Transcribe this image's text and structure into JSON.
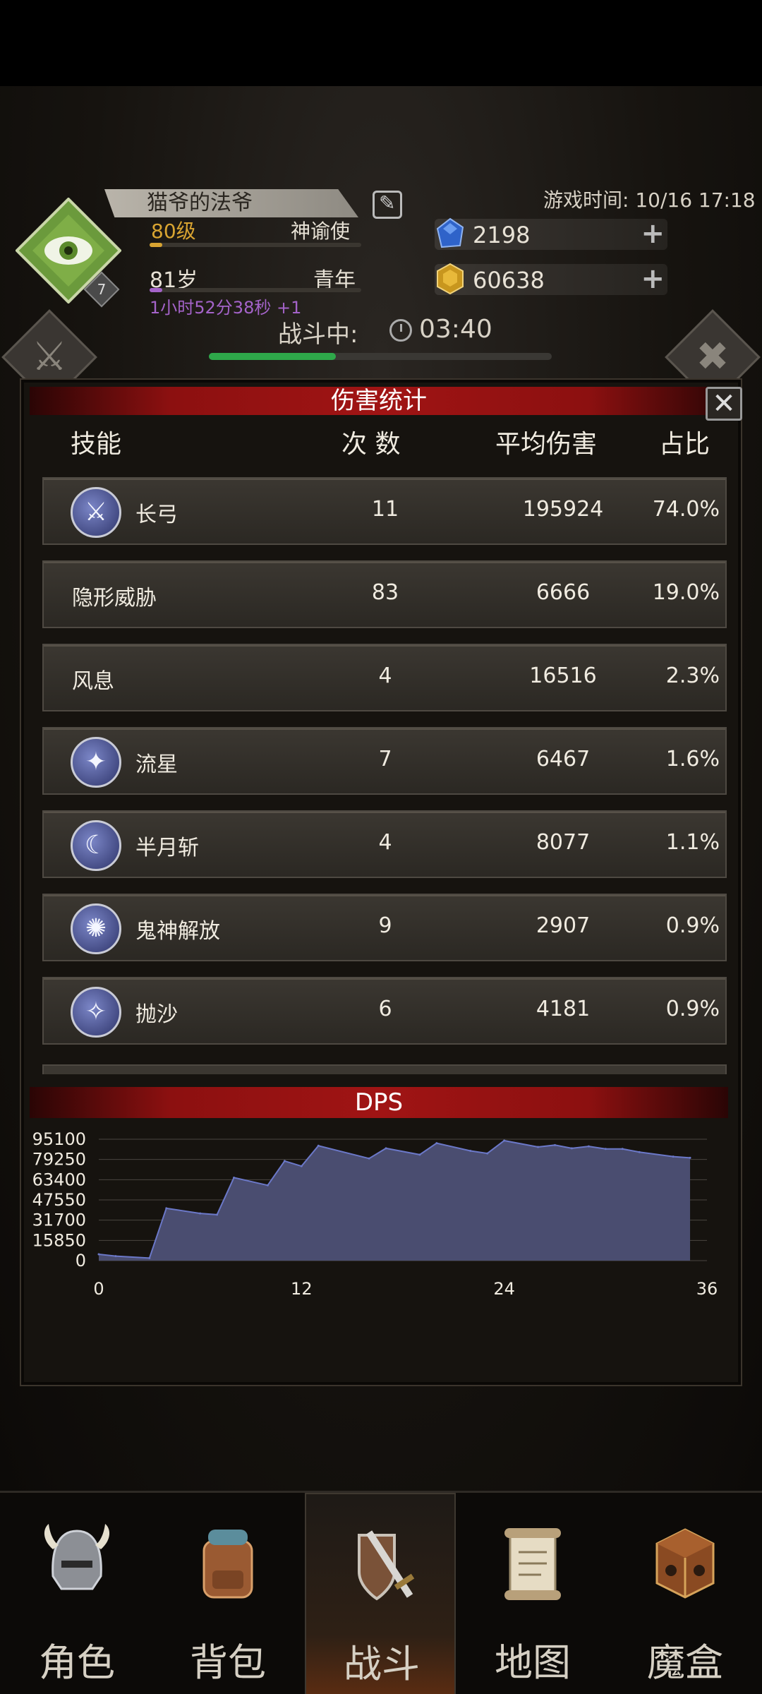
{
  "header": {
    "player_name": "猫爷的法爷",
    "level": "80级",
    "class_name": "神谕使",
    "badge_number": "7",
    "age": "81岁",
    "life_stage": "青年",
    "online_timer": "1小时52分38秒 +1",
    "game_time": "游戏时间: 10/16 17:18",
    "currencies": [
      {
        "icon": "blue-gem-icon",
        "value": "2198"
      },
      {
        "icon": "gold-gem-icon",
        "value": "60638"
      }
    ],
    "battle_label": "战斗中:",
    "battle_timer": "03:40",
    "battle_progress_percent": 37
  },
  "damage_dialog": {
    "title": "伤害统计",
    "close_label": "✕",
    "columns": {
      "skill": "技能",
      "count": "次 数",
      "avg": "平均伤害",
      "ratio": "占比"
    },
    "rows": [
      {
        "name": "长弓",
        "icon": "sword-skill-icon",
        "glyph": "⚔",
        "count": "11",
        "avg": "195924",
        "ratio": "74.0%"
      },
      {
        "name": "隐形威胁",
        "icon": "",
        "glyph": "",
        "count": "83",
        "avg": "6666",
        "ratio": "19.0%"
      },
      {
        "name": "风息",
        "icon": "",
        "glyph": "",
        "count": "4",
        "avg": "16516",
        "ratio": "2.3%"
      },
      {
        "name": "流星",
        "icon": "meteor-skill-icon",
        "glyph": "✦",
        "count": "7",
        "avg": "6467",
        "ratio": "1.6%"
      },
      {
        "name": "半月斩",
        "icon": "crescent-skill-icon",
        "glyph": "☾",
        "count": "4",
        "avg": "8077",
        "ratio": "1.1%"
      },
      {
        "name": "鬼神解放",
        "icon": "spirit-skill-icon",
        "glyph": "✺",
        "count": "9",
        "avg": "2907",
        "ratio": "0.9%"
      },
      {
        "name": "抛沙",
        "icon": "sand-skill-icon",
        "glyph": "✧",
        "count": "6",
        "avg": "4181",
        "ratio": "0.9%"
      }
    ],
    "dps_title": "DPS"
  },
  "chart_data": {
    "type": "area",
    "title": "DPS",
    "xlabel": "",
    "ylabel": "",
    "xlim": [
      0,
      36
    ],
    "ylim": [
      0,
      95100
    ],
    "x_ticks": [
      "0",
      "12",
      "24",
      "36"
    ],
    "y_ticks": [
      "95100",
      "79250",
      "63400",
      "47550",
      "31700",
      "15850",
      "0"
    ],
    "grid": true,
    "colors": {
      "fill": "#4a4d70",
      "line": "#6b78c8"
    },
    "x": [
      0,
      1,
      3,
      4,
      6,
      7,
      8,
      10,
      11,
      12,
      13,
      16,
      17,
      19,
      20,
      22,
      23,
      24,
      26,
      27,
      28,
      29,
      30,
      31,
      32,
      34,
      35
    ],
    "y": [
      5000,
      3500,
      2000,
      41000,
      37000,
      36000,
      65000,
      59000,
      78000,
      74000,
      90000,
      80000,
      88000,
      83000,
      92000,
      86000,
      84000,
      94000,
      89000,
      90500,
      88000,
      89500,
      87500,
      87500,
      85000,
      81500,
      80500
    ]
  },
  "bottom_nav": {
    "items": [
      {
        "label": "角色",
        "icon": "helmet-icon"
      },
      {
        "label": "背包",
        "icon": "backpack-icon"
      },
      {
        "label": "战斗",
        "icon": "sword-shield-icon"
      },
      {
        "label": "地图",
        "icon": "scroll-map-icon"
      },
      {
        "label": "魔盒",
        "icon": "magic-box-icon"
      }
    ],
    "active": "战斗"
  }
}
